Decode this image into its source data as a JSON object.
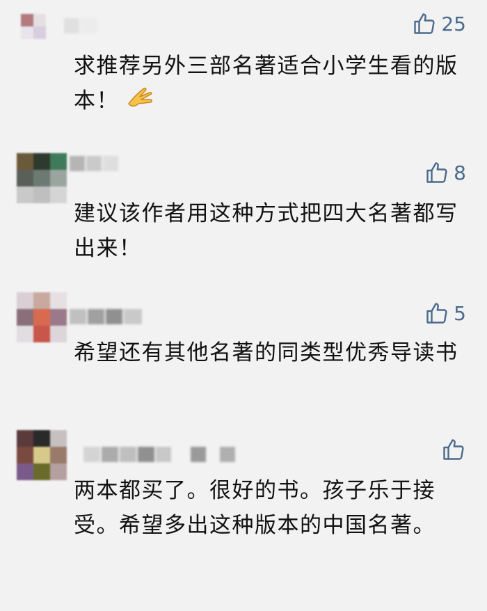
{
  "comments": [
    {
      "likes": "25",
      "text": "求推荐另外三部名著适合小学生看的版本！",
      "emoji": "ok-hand-emoji",
      "avatar_colors": [
        "#b37a80",
        "#e6dfe2",
        "#f2f2f2",
        "#e9e3ec",
        "#d7cfe0",
        "#f2f2f2",
        "#f2f2f2",
        "#f2f2f2",
        "#f2f2f2"
      ],
      "nickname_blocks": [
        "#dcdcdc",
        "#e8e8e8",
        "#e5e5e5"
      ]
    },
    {
      "likes": "8",
      "text": "建议该作者用这种方式把四大名著都写出来！",
      "avatar_colors": [
        "#6b5a3a",
        "#2e3a2e",
        "#3f7a5a",
        "#5a5f5a",
        "#6b7a72",
        "#9aa5a0",
        "#c9c9c9",
        "#bfbfbf",
        "#d5d5d5"
      ],
      "nickname_blocks": [
        "#b5b5b5",
        "#c8c8c8",
        "#d9d9d9"
      ]
    },
    {
      "likes": "5",
      "text": "希望还有其他名著的同类型优秀导读书",
      "avatar_colors": [
        "#d9cfd5",
        "#c7a9a0",
        "#e6e0e3",
        "#8a6f7a",
        "#d86a50",
        "#9a7a8a",
        "#e1dde0",
        "#c9564a",
        "#dcd6da"
      ],
      "nickname_blocks": [
        "#bdbdbd",
        "#9a9a9a",
        "#8a8a8a",
        "#c5c5c5"
      ]
    },
    {
      "likes": "",
      "text": "两本都买了。很好的书。孩子乐于接受。希望多出这种版本的中国名著。",
      "avatar_colors": [
        "#5a3a3a",
        "#2a2a2a",
        "#c7c0c0",
        "#7a4a40",
        "#d6c98a",
        "#9a7a6a",
        "#7a5a8a",
        "#6a6a2a",
        "#b5a0a0"
      ],
      "nickname_blocks": [
        "#d0d0d0",
        "#a9a9a9",
        "#bcbcbc",
        "#8f8f8f",
        "#c4c4c4",
        "#9a9a9a",
        "#b0b0b0"
      ]
    }
  ]
}
